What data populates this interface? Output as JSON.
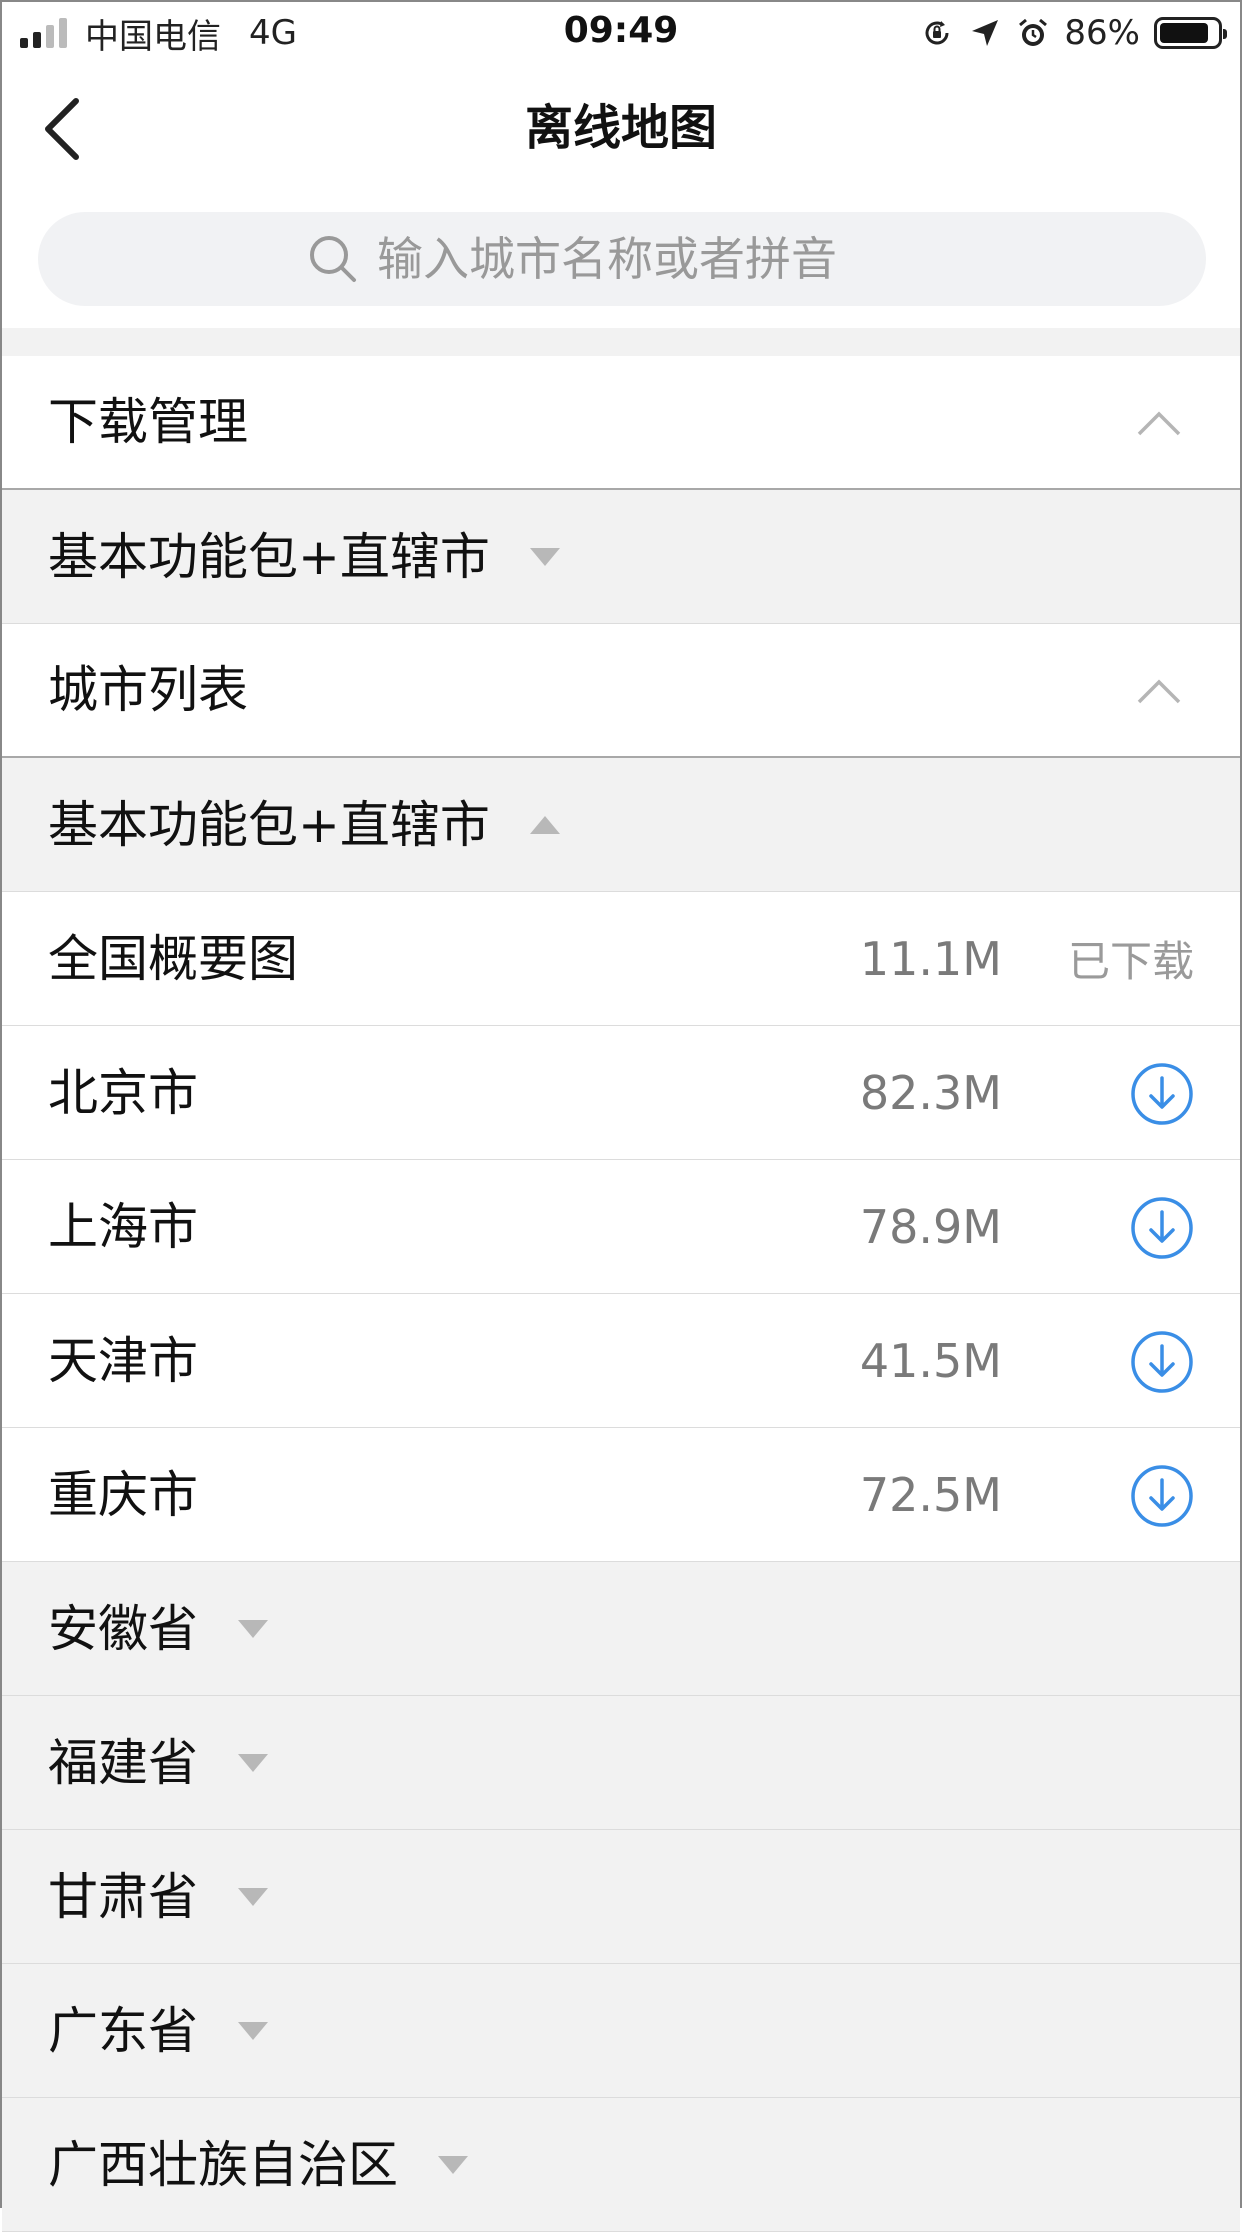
{
  "status_bar": {
    "carrier": "中国电信",
    "network": "4G",
    "time": "09:49",
    "battery_percent": "86%",
    "battery_level": 0.86,
    "icons": [
      "signal-icon",
      "orientation-lock-icon",
      "location-icon",
      "alarm-icon",
      "battery-icon"
    ]
  },
  "nav": {
    "title": "离线地图",
    "back_icon": "chevron-left-icon"
  },
  "search": {
    "placeholder": "输入城市名称或者拼音",
    "value": "",
    "icon": "search-icon"
  },
  "download_management": {
    "title": "下载管理",
    "group_label": "基本功能包+直辖市"
  },
  "city_list": {
    "title": "城市列表",
    "expanded_group": "基本功能包+直辖市",
    "items": [
      {
        "name": "全国概要图",
        "size": "11.1M",
        "status": "已下载"
      },
      {
        "name": "北京市",
        "size": "82.3M"
      },
      {
        "name": "上海市",
        "size": "78.9M"
      },
      {
        "name": "天津市",
        "size": "41.5M"
      },
      {
        "name": "重庆市",
        "size": "72.5M"
      }
    ],
    "provinces": [
      "安徽省",
      "福建省",
      "甘肃省",
      "广东省",
      "广西壮族自治区"
    ]
  },
  "colors": {
    "accent": "#3a8ee6",
    "gray_band": "#f2f2f2",
    "muted_text": "#7a7a7a"
  }
}
